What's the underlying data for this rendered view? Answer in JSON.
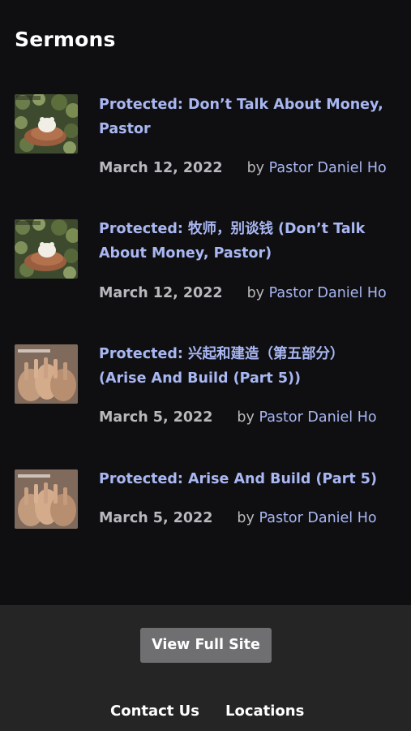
{
  "page": {
    "title": "Sermons"
  },
  "sermons": [
    {
      "title": "Protected: Don’t Talk About Money, Pastor",
      "date": "March 12, 2022",
      "by": "by",
      "author": "Pastor Daniel Ho",
      "thumbnail": "money-hands-thumbnail"
    },
    {
      "title": "Protected: 牧师，别谈钱 (Don’t Talk About Money, Pastor)",
      "date": "March 12, 2022",
      "by": "by",
      "author": "Pastor Daniel Ho",
      "thumbnail": "money-hands-thumbnail"
    },
    {
      "title": "Protected: 兴起和建造（第五部分） (Arise And Build (Part 5))",
      "date": "March 5, 2022",
      "by": "by",
      "author": "Pastor Daniel Ho",
      "thumbnail": "arise-build-thumbnail"
    },
    {
      "title": "Protected: Arise And Build (Part 5)",
      "date": "March 5, 2022",
      "by": "by",
      "author": "Pastor Daniel Ho",
      "thumbnail": "arise-build-thumbnail"
    }
  ],
  "footer": {
    "view_full_site": "View Full Site",
    "contact_us": "Contact Us",
    "locations": "Locations"
  },
  "colors": {
    "link": "#a9b7f2",
    "background": "#0f0f12",
    "footer": "#252526",
    "button": "#6f6f71"
  }
}
